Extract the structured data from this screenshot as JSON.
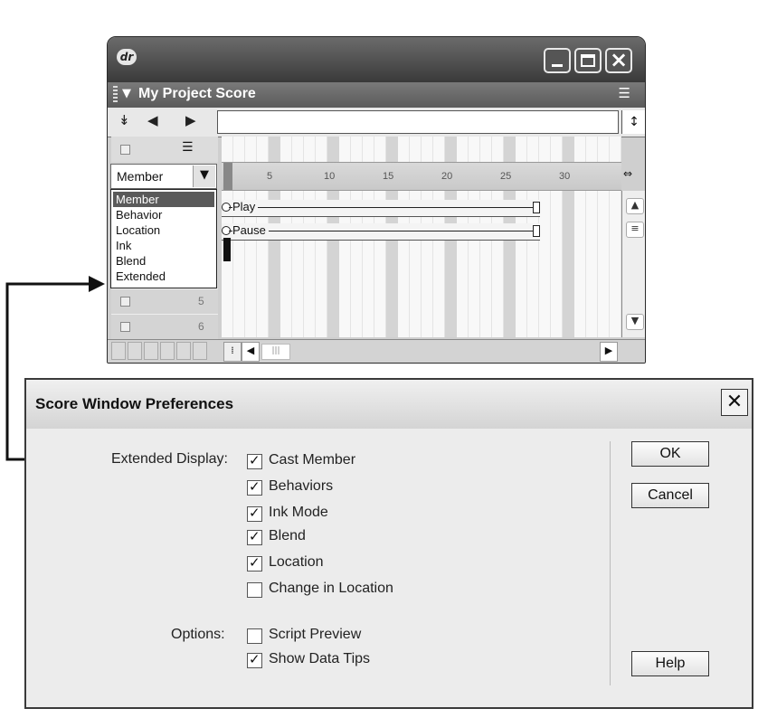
{
  "score_window": {
    "title": "My Project Score",
    "channel_selector": {
      "selected": "Member",
      "options": [
        "Member",
        "Behavior",
        "Location",
        "Ink",
        "Blend",
        "Extended"
      ]
    },
    "channel_numbers": [
      "5",
      "6"
    ],
    "ruler_ticks": [
      "5",
      "10",
      "15",
      "20",
      "25",
      "30"
    ],
    "sprites": [
      {
        "label": "Play"
      },
      {
        "label": "Pause"
      }
    ]
  },
  "preferences_dialog": {
    "title": "Score Window Preferences",
    "extended_display_label": "Extended Display:",
    "extended_display_options": [
      {
        "label": "Cast Member",
        "checked": true
      },
      {
        "label": "Behaviors",
        "checked": true
      },
      {
        "label": "Ink Mode",
        "checked": true
      },
      {
        "label": "Blend",
        "checked": true
      },
      {
        "label": "Location",
        "checked": true
      },
      {
        "label": "Change in Location",
        "checked": false
      }
    ],
    "options_label": "Options:",
    "options": [
      {
        "label": "Script Preview",
        "checked": false
      },
      {
        "label": "Show Data Tips",
        "checked": true
      }
    ],
    "buttons": {
      "ok": "OK",
      "cancel": "Cancel",
      "help": "Help"
    }
  }
}
